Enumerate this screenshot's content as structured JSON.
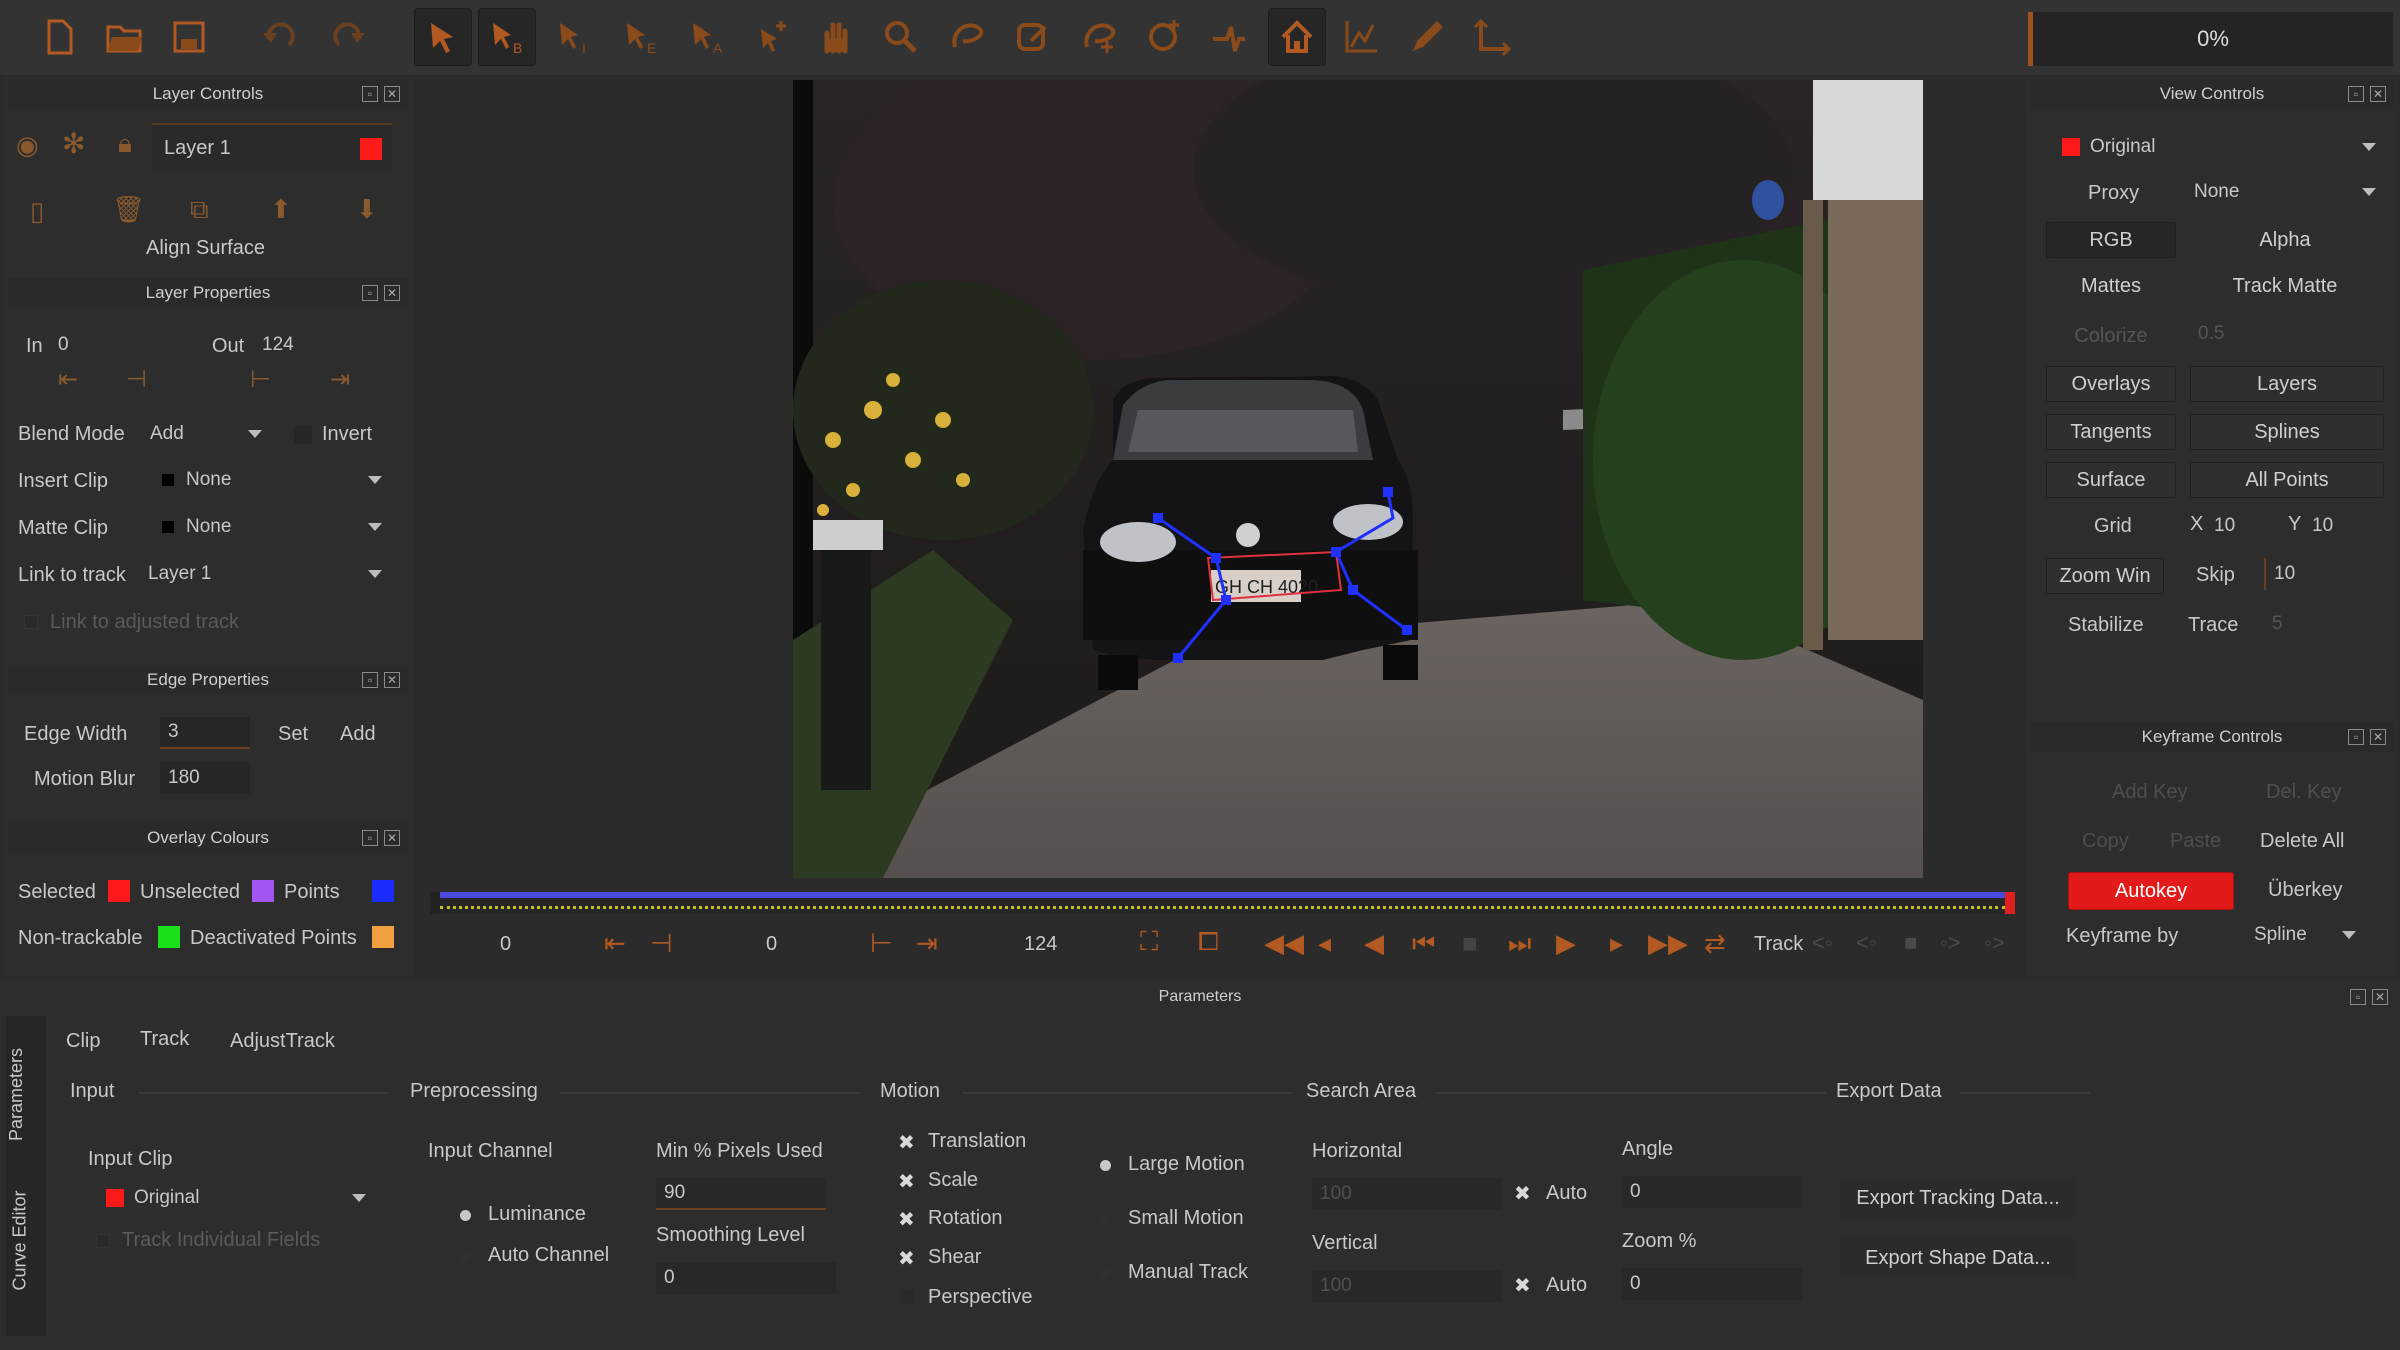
{
  "progress": "0%",
  "toolbar": {
    "icons": [
      "new-file-icon",
      "open-folder-icon",
      "save-icon",
      "undo-icon",
      "redo-icon",
      "select-arrow-icon",
      "select-b-icon",
      "select-i-icon",
      "select-e-icon",
      "select-a-icon",
      "add-point-icon",
      "pan-hand-icon",
      "zoom-icon",
      "shape-draw-icon",
      "shape-edit-icon",
      "shape-add-icon",
      "shape-feather-icon",
      "tracker-icon",
      "home-icon",
      "graph-icon",
      "pen-icon",
      "axis-icon"
    ]
  },
  "layer_controls": {
    "title": "Layer Controls",
    "layer_name": "Layer 1",
    "layer_color": "#ff1a1a",
    "align_surface": "Align Surface"
  },
  "layer_properties": {
    "title": "Layer Properties",
    "in_label": "In",
    "in_value": "0",
    "out_label": "Out",
    "out_value": "124",
    "blend_mode_label": "Blend Mode",
    "blend_mode_value": "Add",
    "invert_label": "Invert",
    "insert_clip_label": "Insert Clip",
    "insert_clip_value": "None",
    "matte_clip_label": "Matte Clip",
    "matte_clip_value": "None",
    "link_to_track_label": "Link to track",
    "link_to_track_value": "Layer 1",
    "link_adjusted_label": "Link to adjusted track"
  },
  "edge_properties": {
    "title": "Edge Properties",
    "edge_width_label": "Edge Width",
    "edge_width_value": "3",
    "set_label": "Set",
    "add_label": "Add",
    "motion_blur_label": "Motion Blur",
    "motion_blur_value": "180"
  },
  "overlay_colours": {
    "title": "Overlay Colours",
    "selected_label": "Selected",
    "selected_color": "#ff1a1a",
    "unselected_label": "Unselected",
    "unselected_color": "#a355f0",
    "points_label": "Points",
    "points_color": "#1a2cff",
    "nontrackable_label": "Non-trackable",
    "nontrackable_color": "#1adf1a",
    "deactivated_label": "Deactivated Points",
    "deactivated_color": "#f0a040"
  },
  "viewer": {
    "plate_text": "GH CH 4020"
  },
  "timeline": {
    "start": "0",
    "current": "0",
    "end": "124",
    "track_label": "Track"
  },
  "view_controls": {
    "title": "View Controls",
    "source_value": "Original",
    "source_color": "#ff1a1a",
    "proxy_label": "Proxy",
    "proxy_value": "None",
    "rgb": "RGB",
    "alpha": "Alpha",
    "mattes": "Mattes",
    "track_matte": "Track Matte",
    "colorize": "Colorize",
    "colorize_value": "0.5",
    "overlays": "Overlays",
    "layers": "Layers",
    "tangents": "Tangents",
    "splines": "Splines",
    "surface": "Surface",
    "all_points": "All Points",
    "grid_label": "Grid",
    "grid_x_label": "X",
    "grid_x_value": "10",
    "grid_y_label": "Y",
    "grid_y_value": "10",
    "zoom_win": "Zoom Win",
    "skip_label": "Skip",
    "skip_value": "10",
    "stabilize": "Stabilize",
    "trace_label": "Trace",
    "trace_value": "5"
  },
  "keyframe_controls": {
    "title": "Keyframe Controls",
    "add_key": "Add Key",
    "del_key": "Del. Key",
    "copy": "Copy",
    "paste": "Paste",
    "delete_all": "Delete All",
    "autokey": "Autokey",
    "uberkey": "Überkey",
    "keyframe_by_label": "Keyframe by",
    "keyframe_by_value": "Spline"
  },
  "parameters": {
    "title": "Parameters",
    "side_tab_parameters": "Parameters",
    "side_tab_curve_editor": "Curve Editor",
    "tabs": [
      "Clip",
      "Track",
      "AdjustTrack"
    ],
    "input": {
      "header": "Input",
      "input_clip_label": "Input Clip",
      "input_clip_value": "Original",
      "input_clip_color": "#ff1a1a",
      "track_fields_label": "Track Individual Fields"
    },
    "preprocessing": {
      "header": "Preprocessing",
      "input_channel_label": "Input Channel",
      "luminance": "Luminance",
      "auto_channel": "Auto Channel",
      "min_pixels_label": "Min % Pixels Used",
      "min_pixels_value": "90",
      "smoothing_label": "Smoothing Level",
      "smoothing_value": "0"
    },
    "motion": {
      "header": "Motion",
      "translation": "Translation",
      "scale": "Scale",
      "rotation": "Rotation",
      "shear": "Shear",
      "perspective": "Perspective",
      "large_motion": "Large Motion",
      "small_motion": "Small Motion",
      "manual_track": "Manual Track"
    },
    "search_area": {
      "header": "Search Area",
      "horizontal_label": "Horizontal",
      "horizontal_value": "100",
      "vertical_label": "Vertical",
      "vertical_value": "100",
      "auto_label": "Auto",
      "angle_label": "Angle",
      "angle_value": "0",
      "zoom_label": "Zoom %",
      "zoom_value": "0"
    },
    "export_data": {
      "header": "Export Data",
      "export_tracking": "Export Tracking Data...",
      "export_shape": "Export Shape Data..."
    }
  }
}
